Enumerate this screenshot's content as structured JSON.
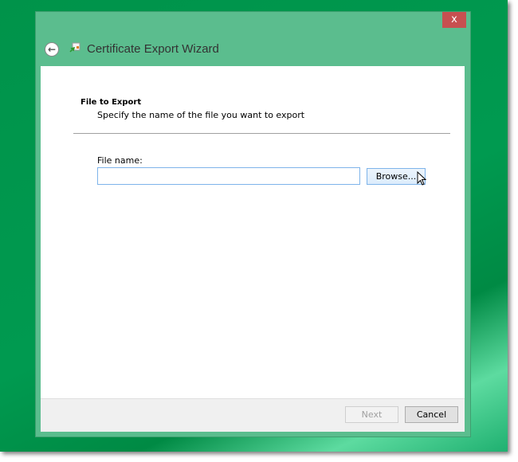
{
  "window": {
    "title": "Certificate Export Wizard",
    "close_label": "x"
  },
  "page": {
    "heading": "File to Export",
    "description": "Specify the name of the file you want to export",
    "file_name_label": "File name:",
    "file_name_value": "",
    "browse_label": "Browse..."
  },
  "footer": {
    "next_label": "Next",
    "cancel_label": "Cancel"
  }
}
